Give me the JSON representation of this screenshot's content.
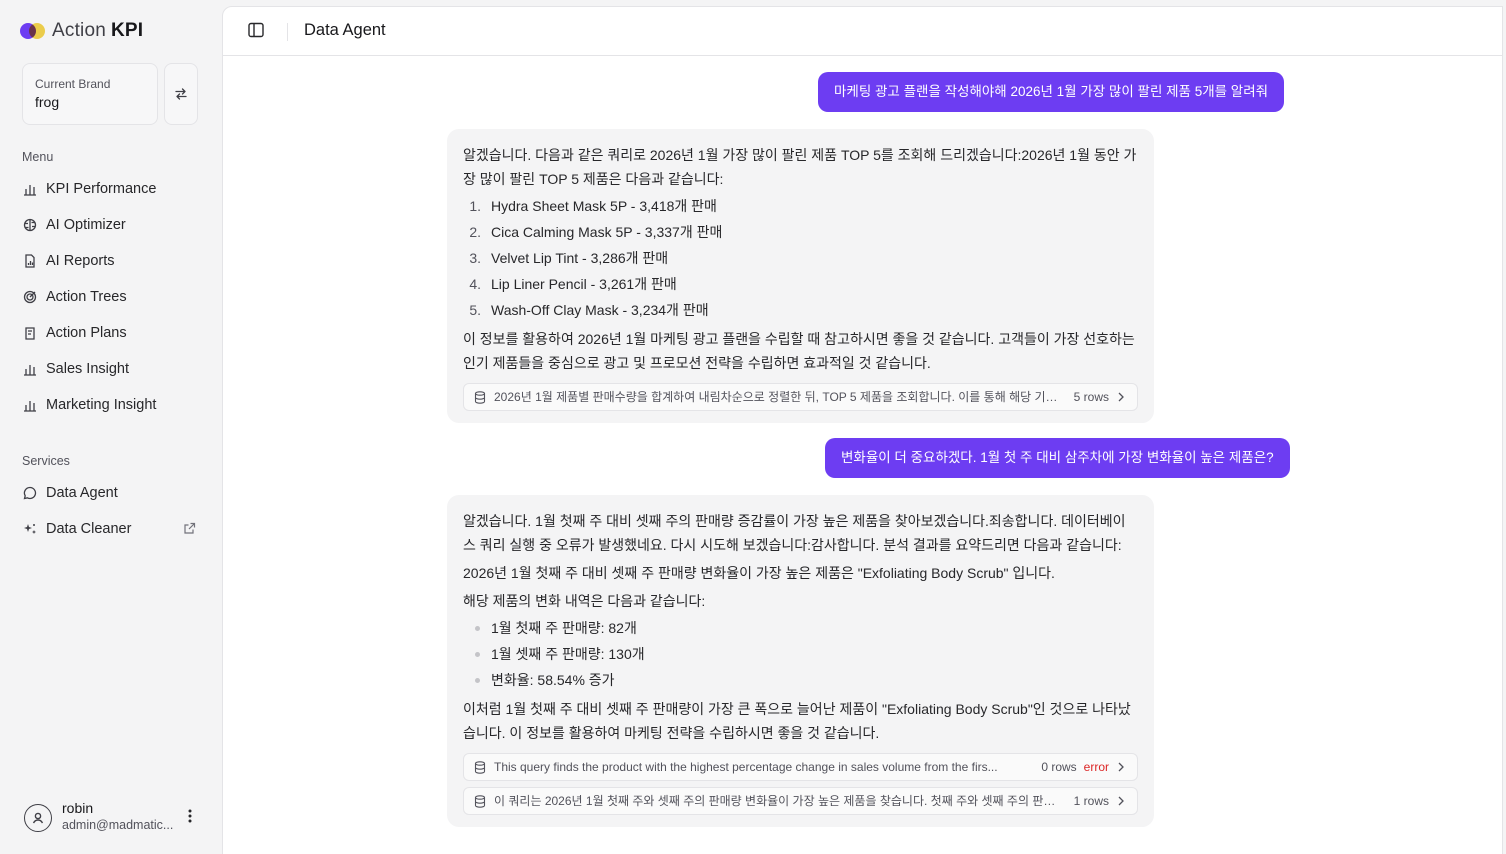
{
  "app": {
    "name": "Action",
    "name_bold": "KPI"
  },
  "brand": {
    "label": "Current Brand",
    "value": "frog"
  },
  "menu": {
    "label": "Menu",
    "items": [
      {
        "label": "KPI Performance",
        "icon": "bar-chart-icon"
      },
      {
        "label": "AI Optimizer",
        "icon": "brain-icon"
      },
      {
        "label": "AI Reports",
        "icon": "file-chart-icon"
      },
      {
        "label": "Action Trees",
        "icon": "target-icon"
      },
      {
        "label": "Action Plans",
        "icon": "clipboard-icon"
      },
      {
        "label": "Sales Insight",
        "icon": "bar-chart-icon"
      },
      {
        "label": "Marketing Insight",
        "icon": "bar-chart-icon"
      }
    ]
  },
  "services": {
    "label": "Services",
    "items": [
      {
        "label": "Data Agent",
        "icon": "chat-icon"
      },
      {
        "label": "Data Cleaner",
        "icon": "sparkles-icon"
      }
    ]
  },
  "user": {
    "name": "robin",
    "email": "admin@madmatic..."
  },
  "header": {
    "title": "Data Agent"
  },
  "conversation": {
    "q1": "마케팅 광고 플랜을 작성해야해 2026년 1월 가장 많이 팔린 제품 5개를 알려줘",
    "a1": {
      "intro": "알겠습니다. 다음과 같은 쿼리로 2026년 1월 가장 많이 팔린 제품 TOP 5를 조회해 드리겠습니다:2026년 1월 동안 가장 많이 팔린 TOP 5 제품은 다음과 같습니다:",
      "items": [
        "Hydra Sheet Mask 5P - 3,418개 판매",
        "Cica Calming Mask 5P - 3,337개 판매",
        "Velvet Lip Tint - 3,286개 판매",
        "Lip Liner Pencil - 3,261개 판매",
        "Wash-Off Clay Mask - 3,234개 판매"
      ],
      "outro": "이 정보를 활용하여 2026년 1월 마케팅 광고 플랜을 수립할 때 참고하시면 좋을 것 같습니다. 고객들이 가장 선호하는 인기 제품들을 중심으로 광고 및 프로모션 전략을 수립하면 효과적일 것 같습니다.",
      "query": {
        "text": "2026년 1월 제품별 판매수량을 합계하여 내림차순으로 정렬한 뒤, TOP 5 제품을 조회합니다. 이를 통해 해당 기간 동안...",
        "rows": "5 rows"
      }
    },
    "q2": "변화율이 더 중요하겠다. 1월 첫 주 대비 삼주차에 가장 변화율이 높은 제품은?",
    "a2": {
      "intro": "알겠습니다. 1월 첫째 주 대비 셋째 주의 판매량 증감률이 가장 높은 제품을 찾아보겠습니다.죄송합니다. 데이터베이스 쿼리 실행 중 오류가 발생했네요. 다시 시도해 보겠습니다:감사합니다. 분석 결과를 요약드리면 다음과 같습니다:",
      "result": "2026년 1월 첫째 주 대비 셋째 주 판매량 변화율이 가장 높은 제품은 \"Exfoliating Body Scrub\" 입니다.",
      "detail_label": "해당 제품의 변화 내역은 다음과 같습니다:",
      "items": [
        "1월 첫째 주 판매량: 82개",
        "1월 셋째 주 판매량: 130개",
        "변화율: 58.54% 증가"
      ],
      "outro": "이처럼 1월 첫째 주 대비 셋째 주 판매량이 가장 큰 폭으로 늘어난 제품이 \"Exfoliating Body Scrub\"인 것으로 나타났습니다. 이 정보를 활용하여 마케팅 전략을 수립하시면 좋을 것 같습니다.",
      "queries": [
        {
          "text": "This query finds the product with the highest percentage change in sales volume from the firs...",
          "rows": "0 rows",
          "status": "error"
        },
        {
          "text": "이 쿼리는 2026년 1월 첫째 주와 셋째 주의 판매량 변화율이 가장 높은 제품을 찾습니다. 첫째 주와 셋째 주의 판매량을 ...",
          "rows": "1 rows"
        }
      ]
    }
  },
  "colors": {
    "accent": "#6d3df2",
    "error": "#dc2626",
    "logo_yellow": "#f5d23a"
  }
}
